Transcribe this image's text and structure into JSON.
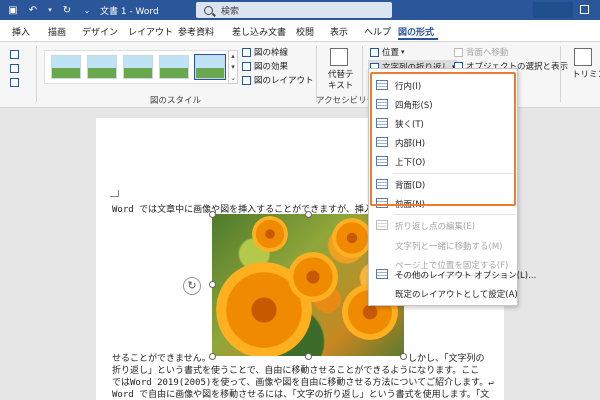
{
  "titlebar": {
    "doc_title": "文書 1  -  Word",
    "search_placeholder": "検索"
  },
  "tabs": [
    {
      "label": "挿入"
    },
    {
      "label": "描画"
    },
    {
      "label": "デザイン"
    },
    {
      "label": "レイアウト"
    },
    {
      "label": "参考資料"
    },
    {
      "label": "差し込み文書"
    },
    {
      "label": "校閲"
    },
    {
      "label": "表示"
    },
    {
      "label": "ヘルプ"
    },
    {
      "label": "図の形式",
      "active": true
    }
  ],
  "ribbon": {
    "picture_border": "図の枠線",
    "picture_effects": "図の効果",
    "picture_layout": "図のレイアウト",
    "picture_styles_group": "図のスタイル",
    "alt_text_line1": "代替テ",
    "alt_text_line2": "キスト",
    "accessibility_group": "アクセシビリティ",
    "position": "位置",
    "wrap_text": "文字列の折り返し",
    "send_backward": "背面へ移動",
    "selection_pane": "オブジェクトの選択と表示",
    "crop": "トリミング"
  },
  "menu": {
    "items": [
      {
        "label": "行内(I)",
        "disabled": false
      },
      {
        "label": "四角形(S)",
        "disabled": false
      },
      {
        "label": "狭く(T)",
        "disabled": false
      },
      {
        "label": "内部(H)",
        "disabled": false
      },
      {
        "label": "上下(O)",
        "disabled": false
      },
      {
        "label": "背面(D)",
        "disabled": false
      },
      {
        "label": "前面(N)",
        "disabled": false
      },
      {
        "label": "折り返し点の編集(E)",
        "disabled": true
      },
      {
        "label": "文字列と一緒に移動する(M)",
        "disabled": true
      },
      {
        "label": "ページ上で位置を固定する(F)",
        "disabled": true
      },
      {
        "label": "その他のレイアウト オプション(L)...",
        "disabled": false
      },
      {
        "label": "既定のレイアウトとして設定(A)",
        "disabled": false
      }
    ]
  },
  "document": {
    "line1": "Word では文章中に画像や図を挿入することができますが、挿入",
    "line2_left": "せることができません。",
    "line2_right": "しかし、「文字列の",
    "line3": "折り返し」という書式を使うことで、自由に移動させることができるようになります。ここ",
    "line4": "ではWord 2019(2005)を使って、画像や図を自由に移動させる方法についてご紹介します。↵",
    "line5": "Word で自由に画像や図を移動させるには、「文字の折り返し」という書式を使用します。「文"
  },
  "colors": {
    "brand": "#2b579a",
    "highlight": "#ee7d31"
  }
}
